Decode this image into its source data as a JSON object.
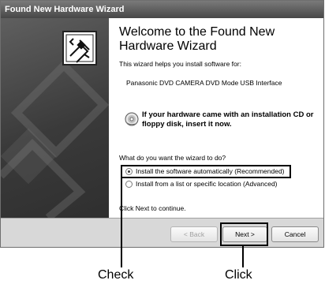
{
  "window": {
    "title": "Found New Hardware Wizard"
  },
  "heading": "Welcome to the Found New Hardware Wizard",
  "intro": "This wizard helps you install software for:",
  "device_name": "Panasonic DVD CAMERA DVD Mode USB Interface",
  "cd_prompt": "If your hardware came with an installation CD or floppy disk, insert it now.",
  "question": "What do you want the wizard to do?",
  "options": [
    {
      "label": "Install the software automatically (Recommended)",
      "selected": true
    },
    {
      "label": "Install from a list or specific location (Advanced)",
      "selected": false
    }
  ],
  "continue_text": "Click Next to continue.",
  "buttons": {
    "back": "< Back",
    "next": "Next >",
    "cancel": "Cancel"
  },
  "callouts": {
    "check": "Check",
    "click": "Click"
  },
  "icons": {
    "wizard": "hardware-wizard-icon",
    "cd": "cd-icon"
  }
}
